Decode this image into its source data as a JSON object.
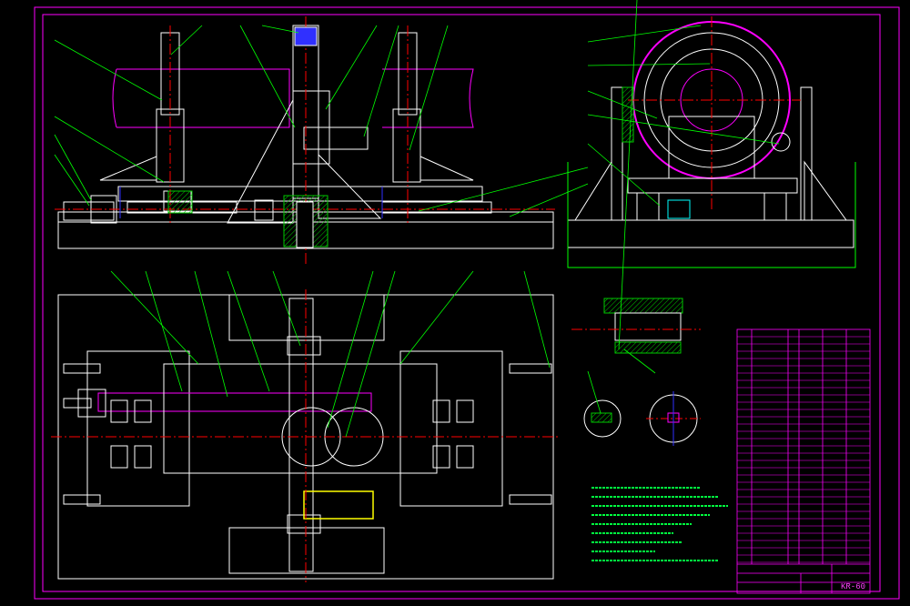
{
  "drawing": {
    "drawing_number": "KR-60"
  },
  "colors": {
    "background": "#000000",
    "frame": "#ff00ff",
    "outline": "#ffffff",
    "centerline": "#ff0000",
    "leader": "#00ff00",
    "hatch": "#00c800",
    "pink_band": "#ff00ff",
    "blue": "#3030ff",
    "yellow": "#ffff00",
    "cyan": "#00ffff"
  }
}
